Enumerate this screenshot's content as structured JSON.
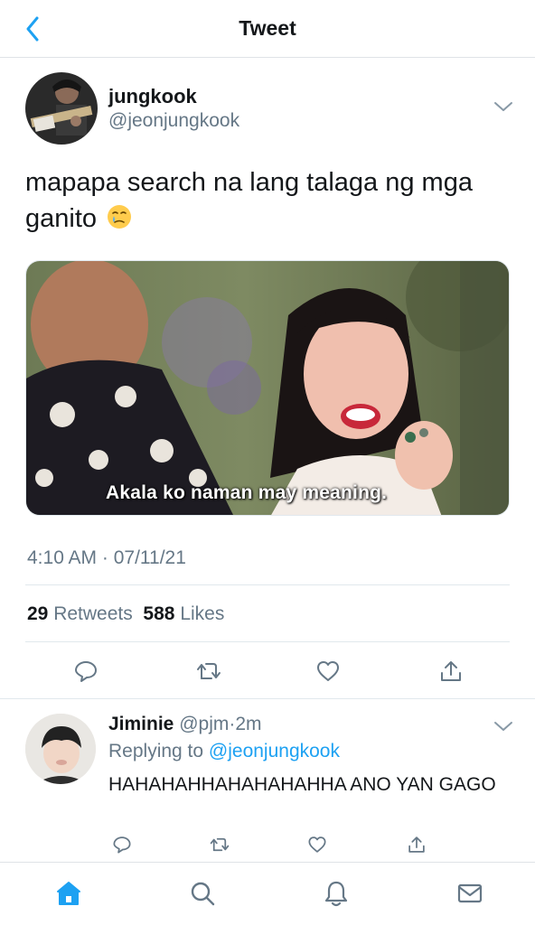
{
  "header": {
    "title": "Tweet",
    "back_icon": "chevron-left-icon"
  },
  "tweet": {
    "author": {
      "name": "jungkook",
      "handle": "@jeonjungkook"
    },
    "text": "mapapa search na lang talaga ng mga ganito",
    "emoji": "crying-face-emoji",
    "media": {
      "subtitle": "Akala ko naman may meaning."
    },
    "timestamp": "4:10 AM · 07/11/21",
    "stats": {
      "retweets_count": "29",
      "retweets_label": "Retweets",
      "likes_count": "588",
      "likes_label": "Likes"
    },
    "actions": [
      "reply-icon",
      "retweet-icon",
      "like-icon",
      "share-icon"
    ]
  },
  "reply": {
    "name": "Jiminie",
    "handle": "@pjm",
    "separator": "·",
    "time": "2m",
    "replying_prefix": "Replying to",
    "replying_to": "@jeonjungkook",
    "text": "HAHAHAHHAHAHAHAHHA ANO YAN GAGO"
  },
  "tabbar": {
    "tabs": [
      {
        "name": "Home",
        "icon": "home-icon",
        "active": true
      },
      {
        "name": "Search",
        "icon": "search-icon",
        "active": false
      },
      {
        "name": "Notifications",
        "icon": "bell-icon",
        "active": false
      },
      {
        "name": "Messages",
        "icon": "mail-icon",
        "active": false
      }
    ]
  },
  "colors": {
    "accent": "#1da1f2",
    "text": "#14171a",
    "secondary": "#657786",
    "divider": "#e1e8ed"
  }
}
